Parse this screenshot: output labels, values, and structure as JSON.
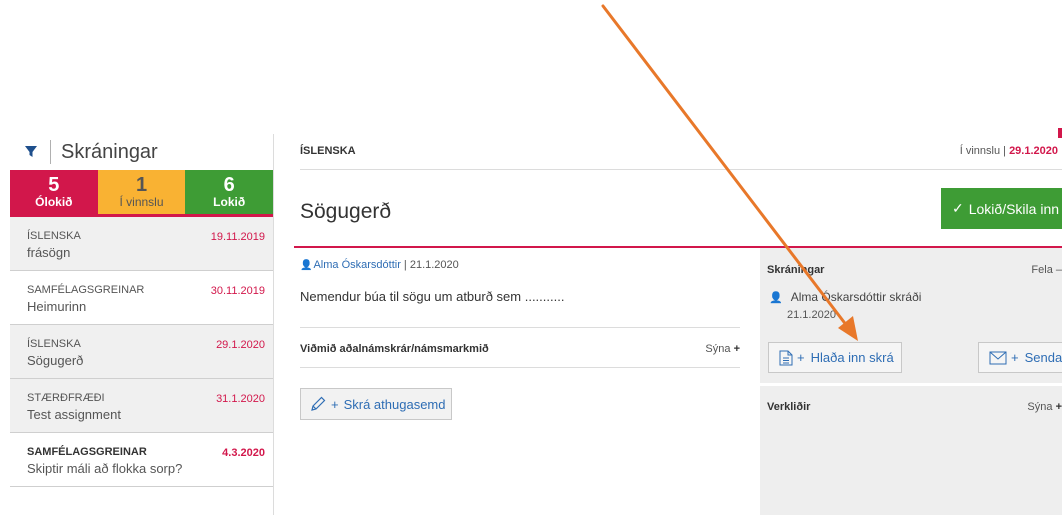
{
  "sidebar": {
    "title": "Skráningar",
    "filter_icon": "filter-icon",
    "tabs": [
      {
        "count": "5",
        "label": "Ólokið",
        "color": "#d2174b"
      },
      {
        "count": "1",
        "label": "Í vinnslu",
        "color": "#f9b233"
      },
      {
        "count": "6",
        "label": "Lokið",
        "color": "#3e9c35"
      }
    ],
    "items": [
      {
        "subject": "ÍSLENSKA",
        "name": "frásögn",
        "date": "19.11.2019"
      },
      {
        "subject": "SAMFÉLAGSGREINAR",
        "name": "Heimurinn",
        "date": "30.11.2019"
      },
      {
        "subject": "ÍSLENSKA",
        "name": "Sögugerð",
        "date": "29.1.2020"
      },
      {
        "subject": "STÆRÐFRÆÐI",
        "name": "Test assignment",
        "date": "31.1.2020"
      },
      {
        "subject": "SAMFÉLAGSGREINAR",
        "name": "Skiptir máli að flokka sorp?",
        "date": "4.3.2020"
      }
    ]
  },
  "main": {
    "subject": "ÍSLENSKA",
    "status_prefix": "Í vinnslu | ",
    "status_date": "29.1.2020",
    "title": "Sögugerð",
    "done_button": "Lokið/Skila inn",
    "author": "Alma Óskarsdóttir",
    "author_date": " | 21.1.2020",
    "description": "Nemendur búa til sögu um atburð sem ...........",
    "criteria_label": "Viðmið aðalnámskrár/námsmarkmið",
    "criteria_show": "Sýna",
    "comment_button": "Skrá athugasemd"
  },
  "right_panel": {
    "title": "Skráningar",
    "hide": "Fela –",
    "user_entry": "Alma Óskarsdóttir skráði",
    "user_date": "21.1.2020",
    "upload_button": "Hlaða inn skrá",
    "send_button": "Senda",
    "tasks_label": "Verkliðir",
    "tasks_show": "Sýna"
  },
  "colors": {
    "accent_red": "#d2174b",
    "accent_green": "#3e9c35",
    "accent_orange": "#f9b233",
    "link_blue": "#2e6db4",
    "annotation_arrow": "#e8782a"
  }
}
